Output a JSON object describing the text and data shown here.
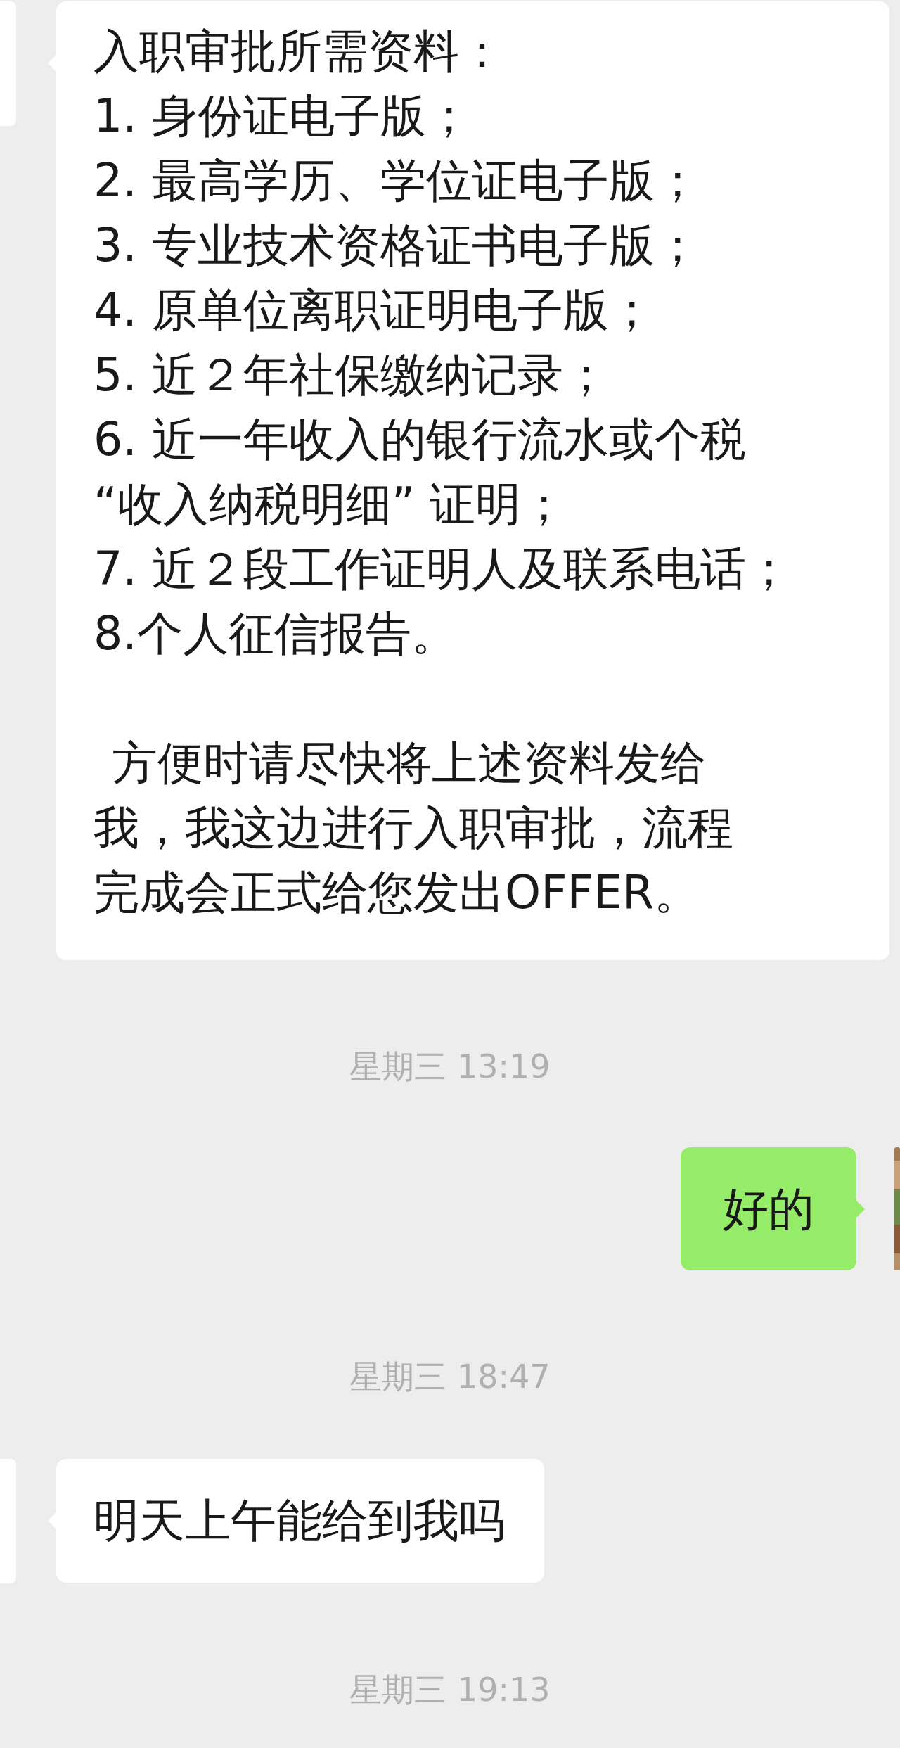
{
  "chat": [
    {
      "kind": "list",
      "heading": "入职审批所需资料：",
      "items": [
        {
          "lines": [
            "1. 身份证电子版；"
          ]
        },
        {
          "lines": [
            "2. 最高学历、学位证电子版；"
          ]
        },
        {
          "lines": [
            "3. 专业技术资格证书电子版；"
          ]
        },
        {
          "lines": [
            "4. 原单位离职证明电子版；"
          ]
        },
        {
          "lines": [
            "5. 近２年社保缴纳记录；"
          ]
        },
        {
          "lines": [
            "6. 近一年收入的银行流水或个税",
            "“收入纳税明细” 证明；"
          ]
        },
        {
          "lines": [
            "7. 近２段工作证明人及联系电话；"
          ]
        },
        {
          "lines": [
            "8.个人征信报告。"
          ]
        }
      ],
      "note": [
        "方便时请尽快将上述资料发给",
        "我，我这边进行入职审批，流程",
        "完成会正式给您发出OFFER。"
      ]
    },
    {
      "kind": "time",
      "text": "星期三 13:19"
    },
    {
      "kind": "outgoing",
      "text": "好的"
    },
    {
      "kind": "time",
      "text": "星期三 18:47"
    },
    {
      "kind": "incoming",
      "text": "明天上午能给到我吗"
    },
    {
      "kind": "time",
      "text": "星期三 19:13"
    }
  ]
}
